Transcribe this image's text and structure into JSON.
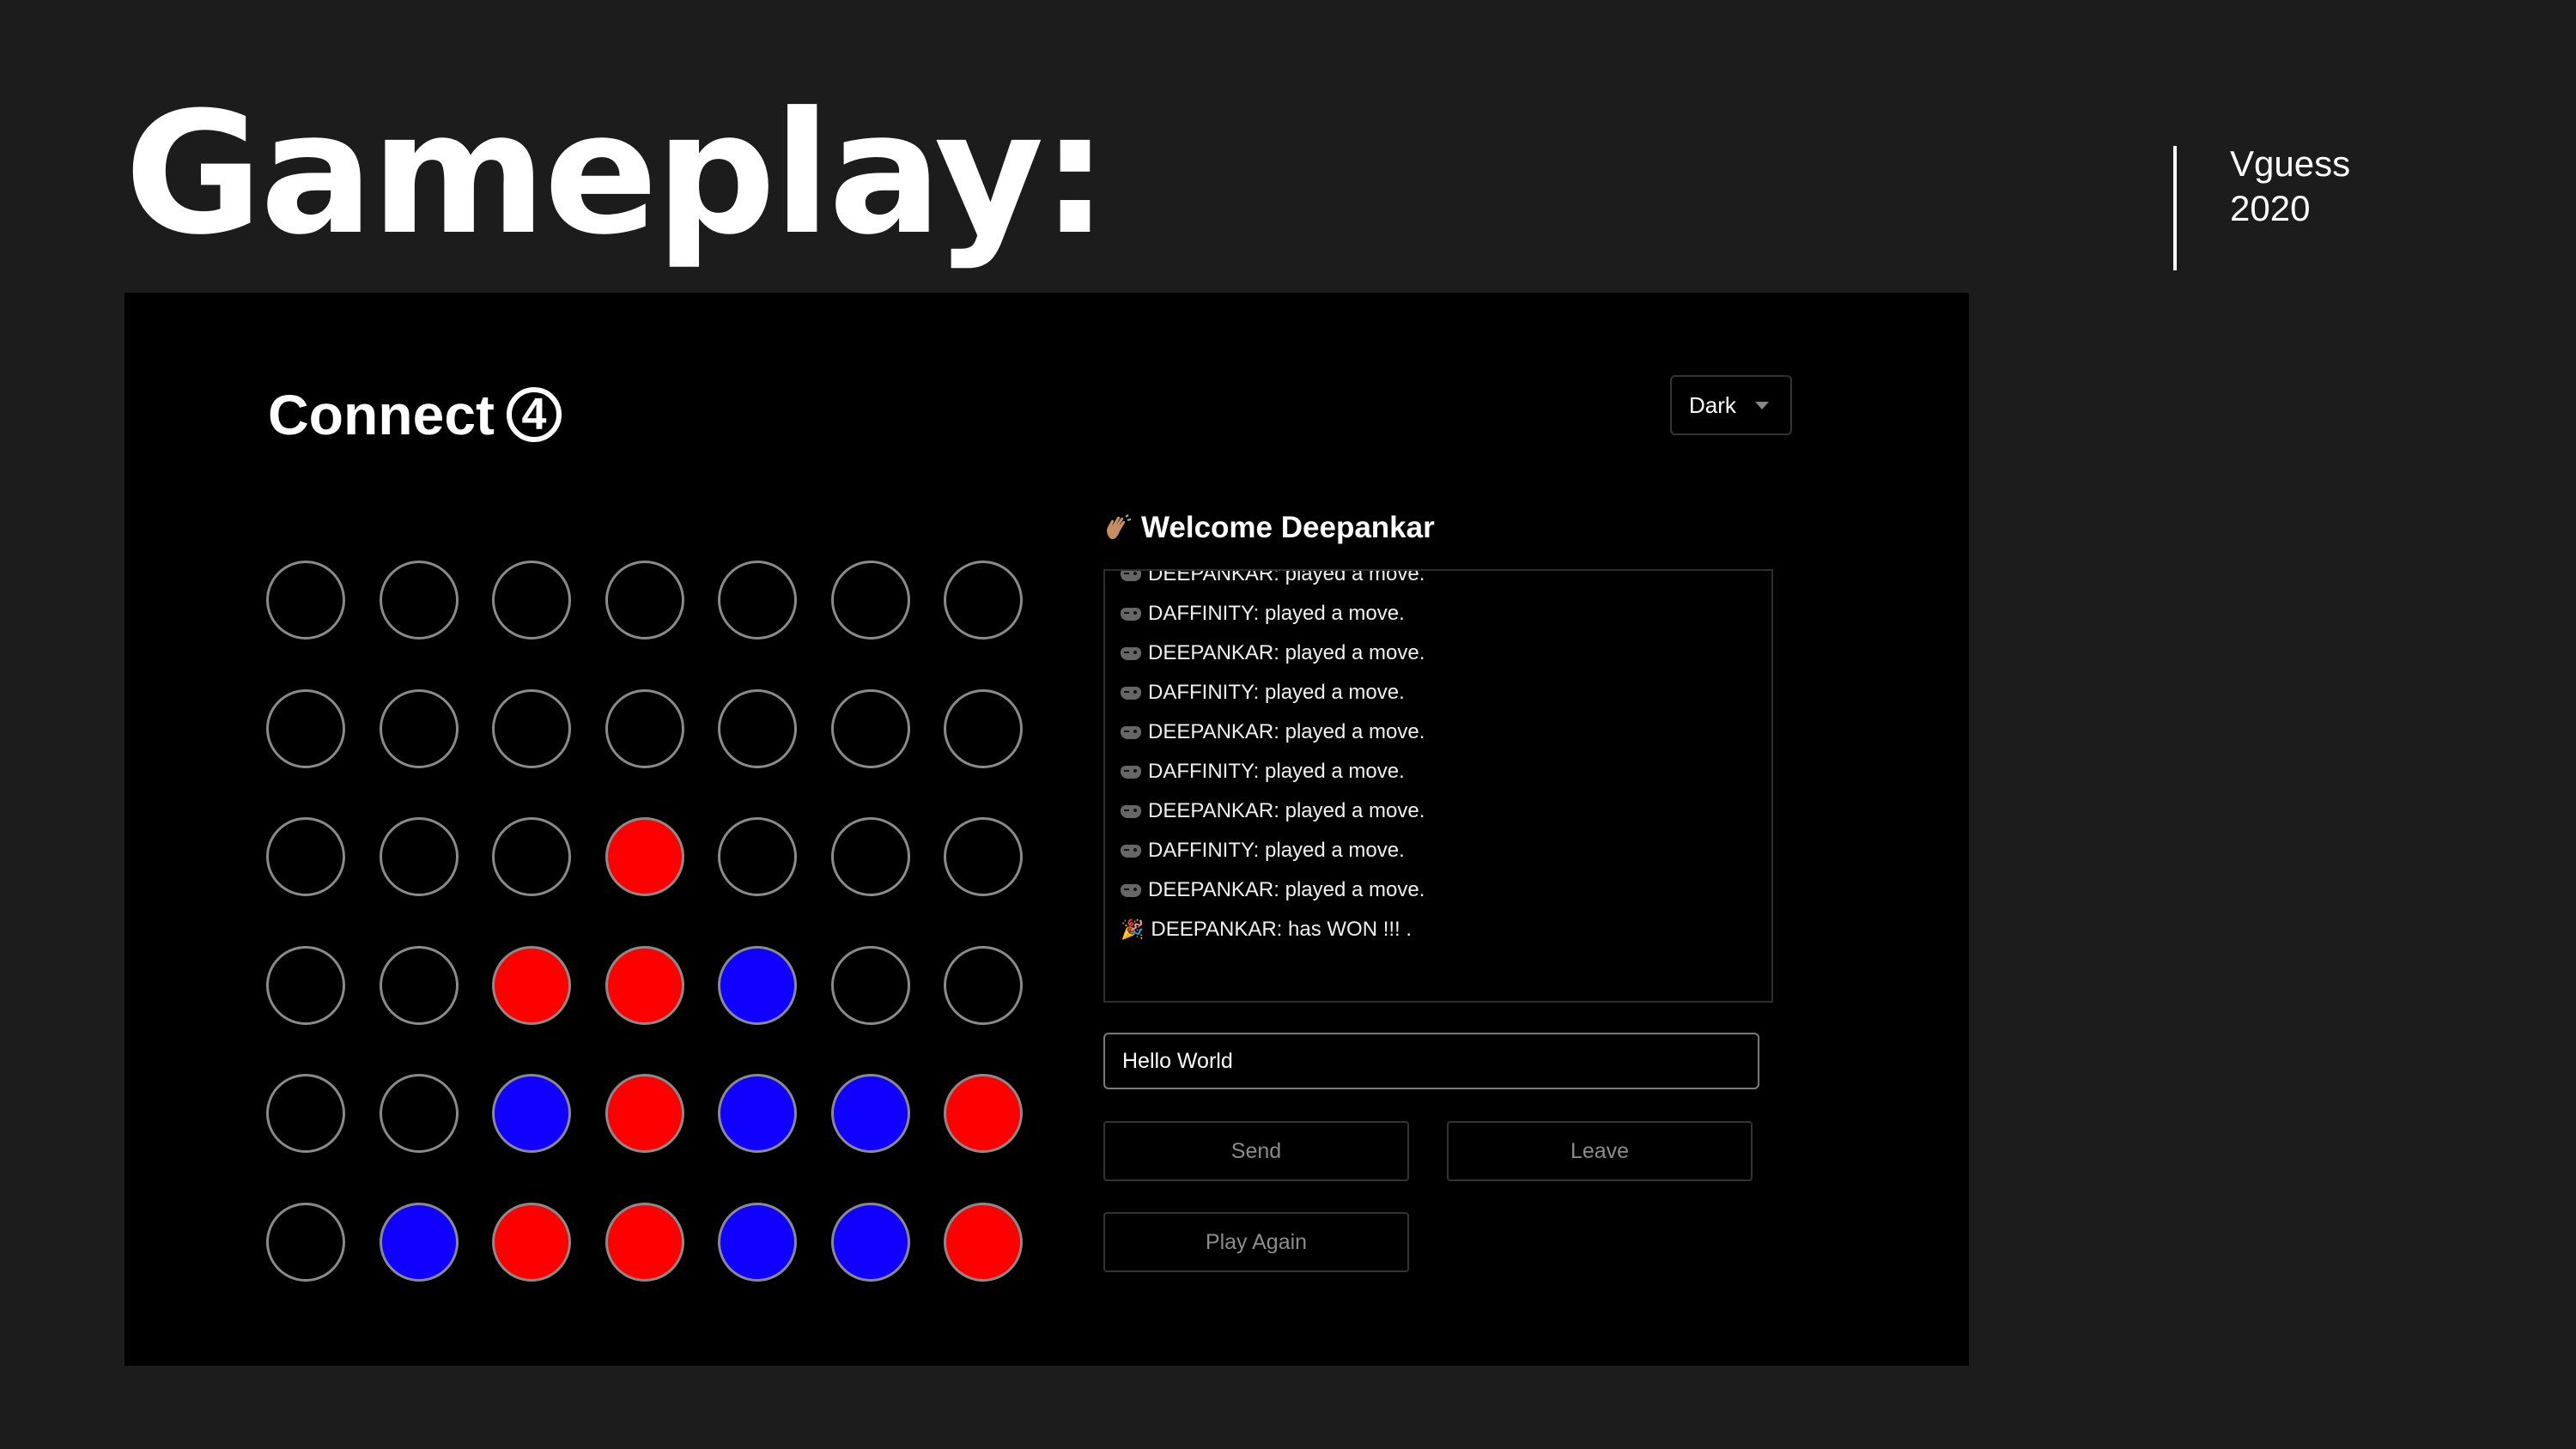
{
  "slide": {
    "title": "Gameplay:",
    "meta_line1": "Vguess",
    "meta_line2": "2020"
  },
  "app": {
    "title": "Connect",
    "title_badge": "4",
    "theme_select": {
      "value": "Dark"
    }
  },
  "colors": {
    "red": "#ff0000",
    "blue": "#1000ff",
    "empty": "#000000",
    "ring": "#8a8a8a"
  },
  "board": {
    "rows": 6,
    "cols": 7,
    "cells": [
      [
        "empty",
        "empty",
        "empty",
        "empty",
        "empty",
        "empty",
        "empty"
      ],
      [
        "empty",
        "empty",
        "empty",
        "empty",
        "empty",
        "empty",
        "empty"
      ],
      [
        "empty",
        "empty",
        "empty",
        "red",
        "empty",
        "empty",
        "empty"
      ],
      [
        "empty",
        "empty",
        "red",
        "red",
        "blue",
        "empty",
        "empty"
      ],
      [
        "empty",
        "empty",
        "blue",
        "red",
        "blue",
        "blue",
        "red"
      ],
      [
        "empty",
        "blue",
        "red",
        "red",
        "blue",
        "blue",
        "red"
      ]
    ]
  },
  "chat": {
    "welcome_icon": "waving-hand-icon",
    "welcome": "Welcome Deepankar",
    "log": [
      {
        "icon": "controller-icon",
        "text": "DEEPANKAR: played a move."
      },
      {
        "icon": "controller-icon",
        "text": "DAFFINITY: played a move."
      },
      {
        "icon": "controller-icon",
        "text": "DEEPANKAR: played a move."
      },
      {
        "icon": "controller-icon",
        "text": "DAFFINITY: played a move."
      },
      {
        "icon": "controller-icon",
        "text": "DEEPANKAR: played a move."
      },
      {
        "icon": "controller-icon",
        "text": "DAFFINITY: played a move."
      },
      {
        "icon": "controller-icon",
        "text": "DEEPANKAR: played a move."
      },
      {
        "icon": "controller-icon",
        "text": "DAFFINITY: played a move."
      },
      {
        "icon": "controller-icon",
        "text": "DEEPANKAR: played a move."
      },
      {
        "icon": "party-popper-icon",
        "text": "DEEPANKAR: has WON !!! ."
      }
    ],
    "input_value": "Hello World",
    "send_label": "Send",
    "leave_label": "Leave",
    "play_again_label": "Play Again"
  }
}
